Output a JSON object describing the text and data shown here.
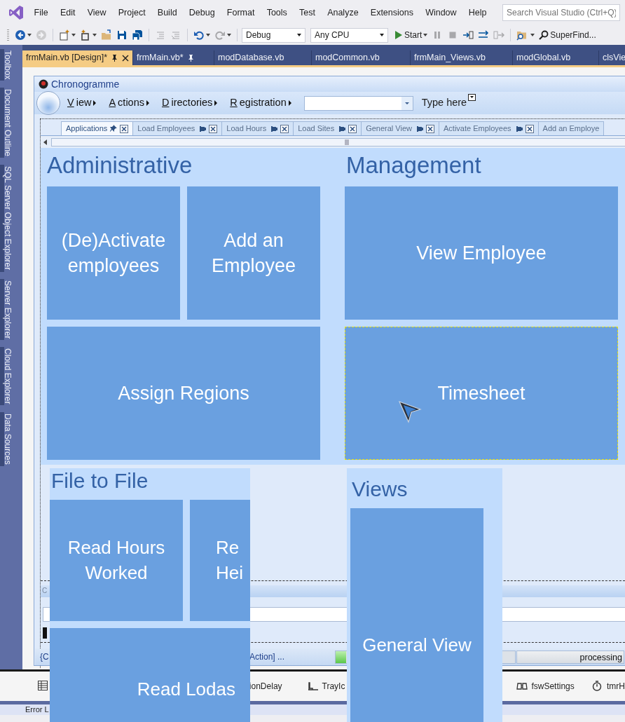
{
  "menu_bar": {
    "items": [
      "File",
      "Edit",
      "View",
      "Project",
      "Build",
      "Debug",
      "Format",
      "Tools",
      "Test",
      "Analyze",
      "Extensions",
      "Window",
      "Help"
    ],
    "search": {
      "placeholder": "Search Visual Studio (Ctrl+Q)"
    }
  },
  "toolbar": {
    "groups": [
      [
        {
          "kind": "back",
          "disabled": false,
          "dropdown": true
        },
        {
          "kind": "forward",
          "disabled": true,
          "dropdown": false
        }
      ],
      [
        {
          "kind": "new-project",
          "disabled": false,
          "dropdown": true
        },
        {
          "kind": "add-item",
          "disabled": false,
          "dropdown": true
        },
        {
          "kind": "open",
          "disabled": false,
          "dropdown": false
        },
        {
          "kind": "save",
          "disabled": false,
          "dropdown": false
        },
        {
          "kind": "save-all",
          "disabled": false,
          "dropdown": false
        }
      ],
      [
        {
          "kind": "comment",
          "disabled": true,
          "dropdown": false
        },
        {
          "kind": "uncomment",
          "disabled": true,
          "dropdown": false
        }
      ],
      [
        {
          "kind": "undo",
          "disabled": false,
          "dropdown": true
        },
        {
          "kind": "redo",
          "disabled": true,
          "dropdown": true
        }
      ]
    ],
    "configuration": "Debug",
    "platform": "Any CPU",
    "start": "Start",
    "debug_buttons": [
      {
        "kind": "pause",
        "disabled": true
      },
      {
        "kind": "stop",
        "disabled": true
      },
      {
        "kind": "step-into",
        "disabled": false
      },
      {
        "kind": "step-over",
        "disabled": false
      },
      {
        "kind": "step-out",
        "disabled": true
      }
    ],
    "find": "SuperFind..."
  },
  "side_tabs": [
    "Toolbox",
    "Document Outline",
    "SQL Server Object Explorer",
    "Server Explorer",
    "Cloud Explorer",
    "Data Sources"
  ],
  "document_tabs": [
    {
      "label": "frmMain.vb [Design]*",
      "selected": true,
      "pinned": true
    },
    {
      "label": "frmMain.vb*",
      "selected": false,
      "pinned": true
    },
    {
      "label": "modDatabase.vb",
      "selected": false,
      "pinned": false
    },
    {
      "label": "modCommon.vb",
      "selected": false,
      "pinned": false
    },
    {
      "label": "frmMain_Views.vb",
      "selected": false,
      "pinned": false
    },
    {
      "label": "modGlobal.vb",
      "selected": false,
      "pinned": false
    },
    {
      "label": "clsVie",
      "selected": false,
      "pinned": false
    }
  ],
  "form": {
    "title": "Chronogramme",
    "menus": [
      "View",
      "Actions",
      "Directories",
      "Registration"
    ],
    "type_here": "Type here",
    "tabs": [
      {
        "label": "Applications",
        "selected": true
      },
      {
        "label": "Load Employees",
        "selected": false
      },
      {
        "label": "Load Hours",
        "selected": false
      },
      {
        "label": "Load Sites",
        "selected": false
      },
      {
        "label": "General View",
        "selected": false
      },
      {
        "label": "Activate Employees",
        "selected": false
      },
      {
        "label": "Add an Employe",
        "selected": false
      }
    ],
    "sections": [
      {
        "heading": "Administrative",
        "tiles": [
          {
            "label": "(De)Activate employees",
            "kind": "square",
            "focused": false
          },
          {
            "label": "Add an Employee",
            "kind": "square",
            "focused": false
          },
          {
            "label": "Assign Regions",
            "kind": "wide",
            "focused": false
          }
        ]
      },
      {
        "heading": "Management",
        "tiles": [
          {
            "label": "View Employee",
            "kind": "wide",
            "focused": false
          },
          {
            "label": "Timesheet",
            "kind": "wide",
            "focused": true
          }
        ]
      }
    ],
    "panel_caption": "C",
    "status_bar": {
      "left": "{C",
      "action": "Action] ...",
      "progress": {
        "level": 0.06
      },
      "status": "processing"
    }
  },
  "overlay_panels": [
    {
      "heading": "File to File",
      "tiles": [
        {
          "label": "Read Hours Worked",
          "kind": "square"
        },
        {
          "label": "Re\nHei",
          "kind": "cut-square"
        },
        {
          "label": "Read Lodas",
          "kind": "cut-wide"
        }
      ]
    },
    {
      "heading": "Views",
      "tiles": [
        {
          "label": "General View",
          "kind": "tall"
        }
      ]
    }
  ],
  "component_tray": [
    {
      "kind": "grid"
    },
    {
      "label": "ionDelay",
      "kind": "none"
    },
    {
      "label": "TrayIc",
      "kind": "tray"
    },
    {
      "label": "fswSettings",
      "kind": "watcher"
    },
    {
      "label": "tmrH",
      "kind": "timer"
    }
  ],
  "bottom_tabs": [
    "Error L"
  ]
}
